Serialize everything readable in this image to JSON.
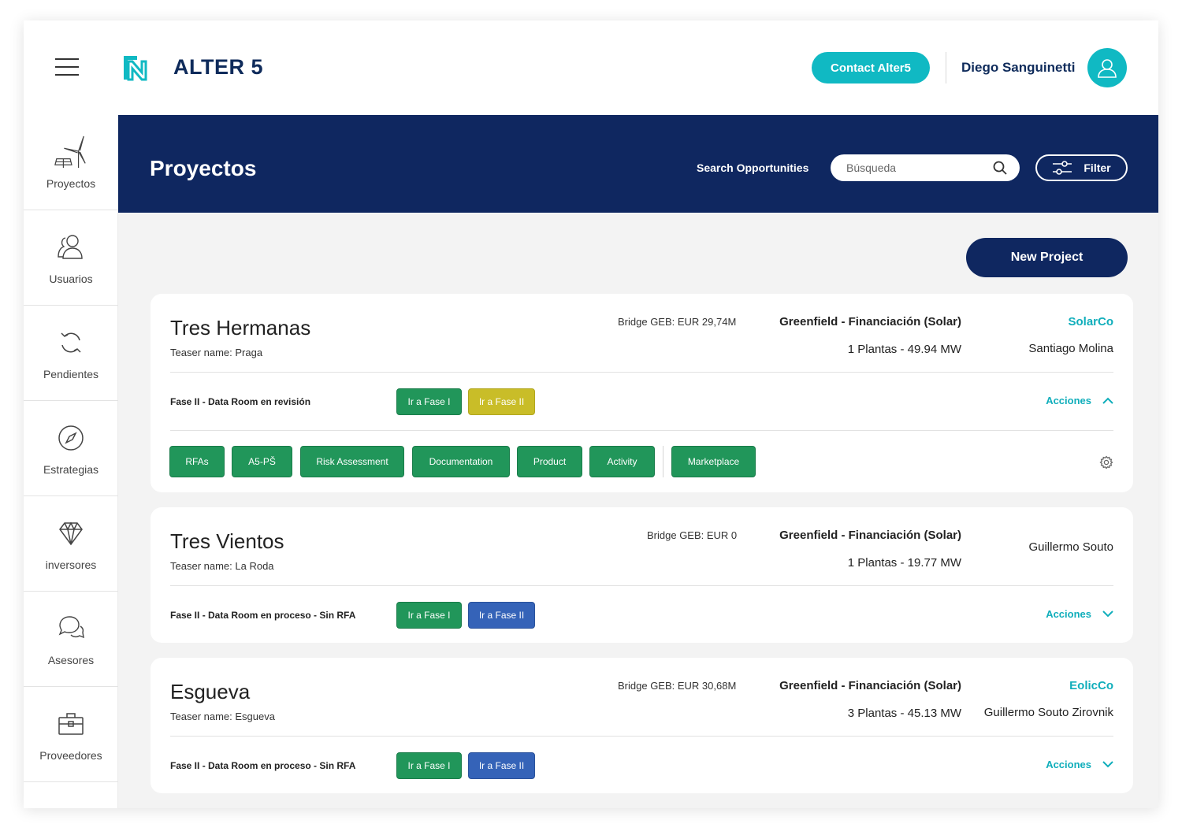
{
  "app": {
    "brand": "ALTER 5",
    "contact_label": "Contact Alter5",
    "user_name": "Diego Sanguinetti"
  },
  "sidebar": {
    "items": [
      {
        "label": "Proyectos",
        "icon": "wind-solar-icon"
      },
      {
        "label": "Usuarios",
        "icon": "users-icon"
      },
      {
        "label": "Pendientes",
        "icon": "refresh-icon"
      },
      {
        "label": "Estrategias",
        "icon": "compass-icon"
      },
      {
        "label": "inversores",
        "icon": "diamond-icon"
      },
      {
        "label": "Asesores",
        "icon": "chat-icon"
      },
      {
        "label": "Proveedores",
        "icon": "briefcase-icon"
      }
    ]
  },
  "header": {
    "title": "Proyectos",
    "search_label": "Search Opportunities",
    "search_placeholder": "Búsqueda",
    "filter_label": "Filter"
  },
  "main": {
    "new_project_label": "New Project",
    "projects": [
      {
        "name": "Tres Hermanas",
        "teaser": "Teaser name: Praga",
        "bridge": "Bridge GEB: EUR 29,74M",
        "type": "Greenfield - Financiación (Solar)",
        "plantas": "1 Plantas - 49.94 MW",
        "company": "SolarCo",
        "person": "Santiago Molina",
        "fase": "Fase II - Data Room en revisión",
        "fase1_label": "Ir a Fase I",
        "fase2_label": "Ir a Fase II",
        "acciones_label": "Acciones",
        "expanded": true,
        "tabs": [
          "RFAs",
          "A5-PŠ",
          "Risk Assessment",
          "Documentation",
          "Product",
          "Activity",
          "Marketplace"
        ]
      },
      {
        "name": "Tres Vientos",
        "teaser": "Teaser name: La Roda",
        "bridge": "Bridge GEB: EUR 0",
        "type": "Greenfield - Financiación (Solar)",
        "plantas": "1 Plantas - 19.77 MW",
        "company": "",
        "person": "Guillermo Souto",
        "fase": "Fase II - Data Room en proceso - Sin RFA",
        "fase1_label": "Ir a Fase I",
        "fase2_label": "Ir a Fase II",
        "acciones_label": "Acciones",
        "expanded": false
      },
      {
        "name": "Esgueva",
        "teaser": "Teaser name: Esgueva",
        "bridge": "Bridge GEB: EUR 30,68M",
        "type": "Greenfield - Financiación (Solar)",
        "plantas": "3 Plantas - 45.13 MW",
        "company": "EolicCo",
        "person": "Guillermo Souto Zirovnik",
        "fase": "Fase II - Data Room en proceso - Sin RFA",
        "fase1_label": "Ir a Fase I",
        "fase2_label": "Ir a Fase II",
        "acciones_label": "Acciones",
        "expanded": false
      }
    ]
  },
  "colors": {
    "navy": "#0f2760",
    "teal": "#10b9c3",
    "green": "#21965a",
    "yellow": "#c9bd28",
    "blue": "#3563b8"
  }
}
